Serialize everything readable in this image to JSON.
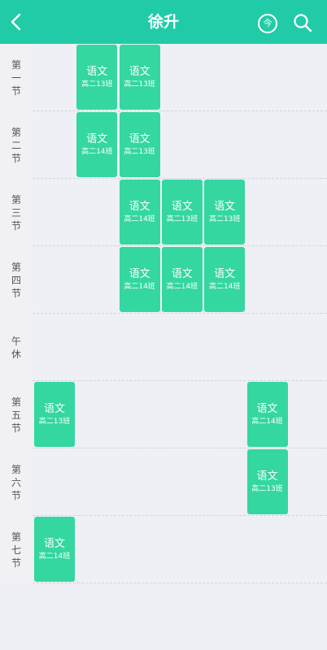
{
  "header": {
    "title": "徐升",
    "today_label": "今",
    "back_icon": "chevron-left-icon",
    "search_icon": "search-icon",
    "background_color": "#22cba8"
  },
  "periods": [
    "第一节",
    "第二节",
    "第三节",
    "第四节",
    "午休",
    "第五节",
    "第六节",
    "第七节"
  ],
  "card_color": "#34d79f",
  "courses": [
    {
      "period": 1,
      "day": 2,
      "name": "语文",
      "class_name": "高二13班"
    },
    {
      "period": 1,
      "day": 3,
      "name": "语文",
      "class_name": "高二13班"
    },
    {
      "period": 2,
      "day": 2,
      "name": "语文",
      "class_name": "高二14班"
    },
    {
      "period": 2,
      "day": 3,
      "name": "语文",
      "class_name": "高二13班"
    },
    {
      "period": 3,
      "day": 3,
      "name": "语文",
      "class_name": "高二14班"
    },
    {
      "period": 3,
      "day": 4,
      "name": "语文",
      "class_name": "高二13班"
    },
    {
      "period": 3,
      "day": 5,
      "name": "语文",
      "class_name": "高二13班"
    },
    {
      "period": 4,
      "day": 3,
      "name": "语文",
      "class_name": "高二14班"
    },
    {
      "period": 4,
      "day": 4,
      "name": "语文",
      "class_name": "高二14班"
    },
    {
      "period": 4,
      "day": 5,
      "name": "语文",
      "class_name": "高二14班"
    },
    {
      "period": 6,
      "day": 1,
      "name": "语文",
      "class_name": "高二13班"
    },
    {
      "period": 6,
      "day": 6,
      "name": "语文",
      "class_name": "高二14班"
    },
    {
      "period": 7,
      "day": 6,
      "name": "语文",
      "class_name": "高二13班"
    },
    {
      "period": 8,
      "day": 1,
      "name": "语文",
      "class_name": "高二14班"
    }
  ]
}
